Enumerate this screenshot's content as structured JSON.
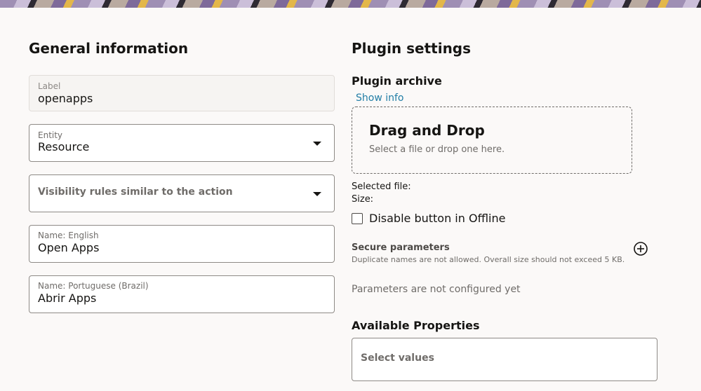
{
  "general": {
    "title": "General information",
    "label_field": {
      "label": "Label",
      "value": "openapps"
    },
    "entity_field": {
      "label": "Entity",
      "value": "Resource"
    },
    "visibility_field": {
      "placeholder": "Visibility rules similar to the action"
    },
    "name_english": {
      "label": "Name: English",
      "value": "Open Apps"
    },
    "name_portuguese": {
      "label": "Name: Portuguese (Brazil)",
      "value": "Abrir Apps"
    }
  },
  "plugin": {
    "title": "Plugin settings",
    "archive_label": "Plugin archive",
    "show_info": "Show info",
    "drop_title": "Drag and Drop",
    "drop_subtitle": "Select a file or drop one here.",
    "selected_file_label": "Selected file:",
    "size_label": "Size:",
    "offline_checkbox_label": "Disable button in Offline",
    "offline_checked": false,
    "secure_title": "Secure parameters",
    "secure_desc": "Duplicate names are not allowed. Overall size should not exceed 5 KB.",
    "params_empty": "Parameters are not configured yet",
    "available_title": "Available Properties",
    "available_placeholder": "Select values"
  },
  "icons": {
    "entity_caret": "chevron-down-icon",
    "visibility_caret": "chevron-down-icon",
    "add_parameter": "plus-circle-icon"
  }
}
